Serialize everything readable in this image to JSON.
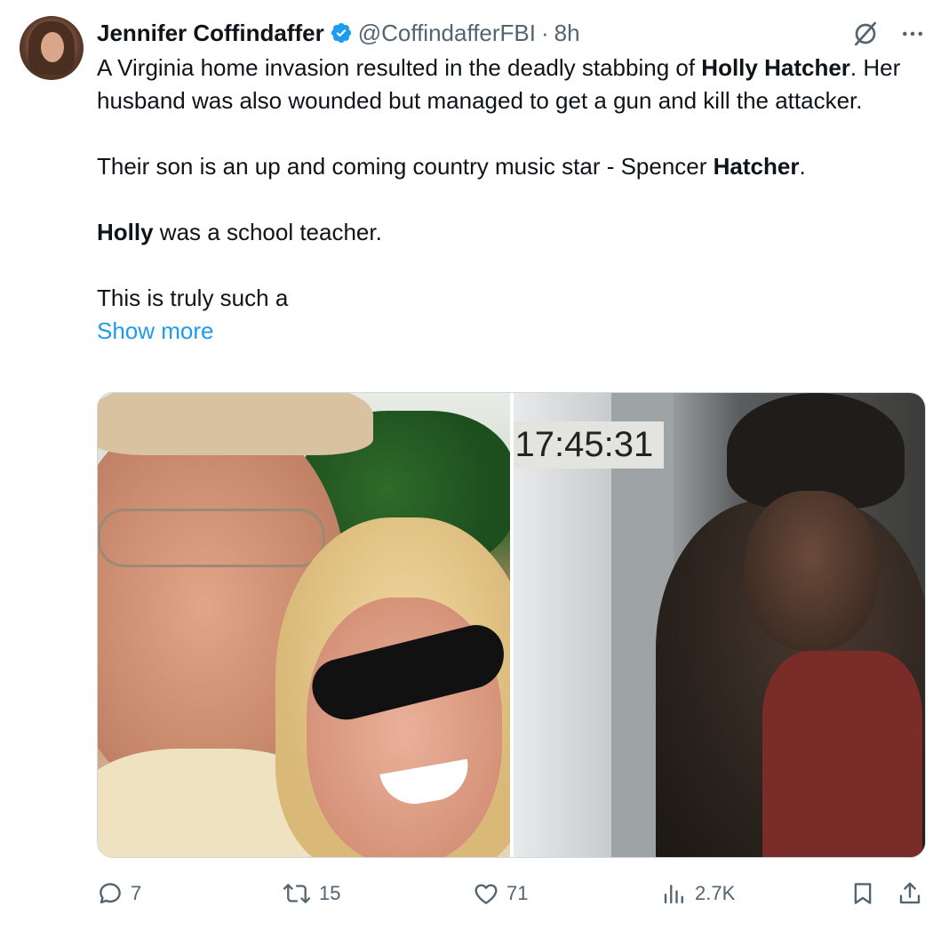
{
  "tweet": {
    "author_name": "Jennifer Coffindaffer",
    "handle": "@CoffindafferFBI",
    "separator": "·",
    "time": "8h",
    "text": {
      "p1_a": "A Virginia home invasion resulted in the deadly stabbing of ",
      "p1_b": "Holly Hatcher",
      "p1_c": ". Her husband was also wounded but managed to get a gun and kill the attacker.",
      "p2_a": "Their son is an up and coming country music star - Spencer ",
      "p2_b": "Hatcher",
      "p2_c": ".",
      "p3_a": "Holly",
      "p3_b": " was a school teacher.",
      "p4": "This is truly such a"
    },
    "show_more": "Show more"
  },
  "media": {
    "right_timestamp": "17:45:31"
  },
  "actions": {
    "replies": "7",
    "reposts": "15",
    "likes": "71",
    "views": "2.7K"
  },
  "icons": {
    "verified": "verified-badge-icon",
    "grok": "grok-icon",
    "more": "more-icon",
    "reply": "reply-icon",
    "repost": "repost-icon",
    "like": "like-icon",
    "views": "views-icon",
    "bookmark": "bookmark-icon",
    "share": "share-icon"
  },
  "colors": {
    "text": "#0f1419",
    "secondary": "#536471",
    "link": "#1d9bf0",
    "verified": "#1d9bf0"
  }
}
